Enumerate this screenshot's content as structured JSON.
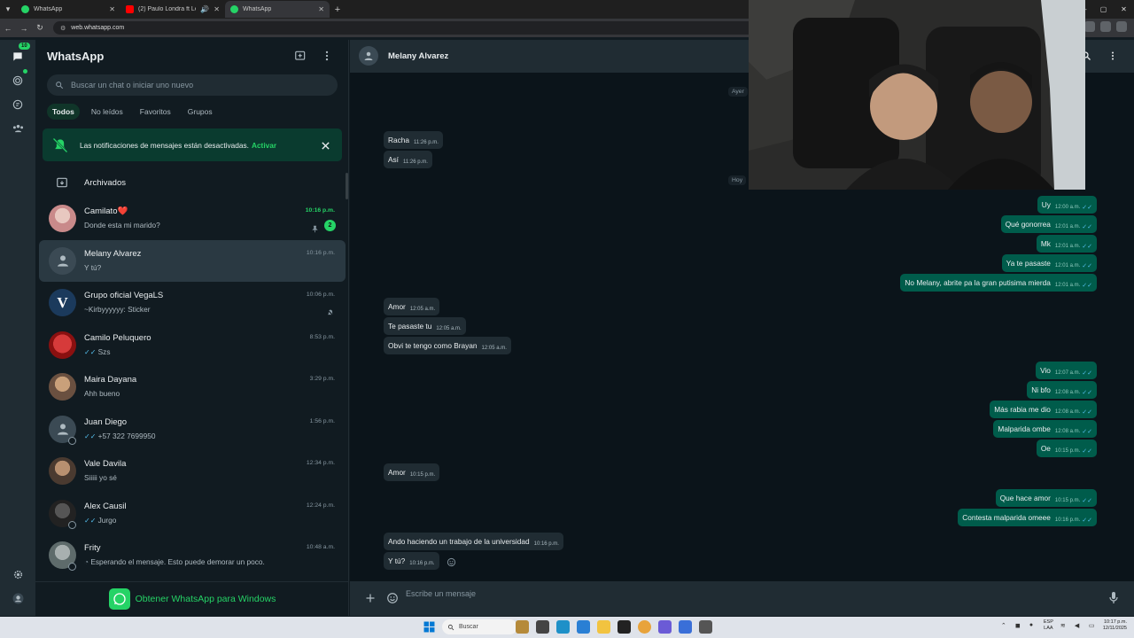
{
  "browser": {
    "tabs": [
      {
        "title": "WhatsApp",
        "active": false
      },
      {
        "title": "(2) Paulo Londra ft Lenny Ta",
        "active": false
      },
      {
        "title": "WhatsApp",
        "active": true
      }
    ],
    "url": "web.whatsapp.com"
  },
  "rail": {
    "chats_badge": "10"
  },
  "sidebar": {
    "title": "WhatsApp",
    "search_placeholder": "Buscar un chat o iniciar uno nuevo",
    "filters": [
      "Todos",
      "No leídos",
      "Favoritos",
      "Grupos"
    ],
    "active_filter": "Todos",
    "notification": {
      "text": "Las notificaciones de mensajes están desactivadas.",
      "link": "Activar"
    },
    "archived_label": "Archivados",
    "chats": [
      {
        "name": "Camilato❤️",
        "preview": "Donde esta mi marido?",
        "time": "10:16 p.m.",
        "unread": "2",
        "pinned": true,
        "avatar": "photo-pink"
      },
      {
        "name": "Melany Alvarez",
        "preview": "Y tú?",
        "time": "10:16 p.m.",
        "selected": true,
        "avatar": "person"
      },
      {
        "name": "Grupo oficial VegaLS",
        "preview": "~Kirbyyyyyy: Sticker",
        "time": "10:06 p.m.",
        "muted": true,
        "avatar": "logo-v"
      },
      {
        "name": "Camilo Peluquero",
        "preview": "Szs",
        "time": "8:53 p.m.",
        "tick": true,
        "avatar": "photo-red"
      },
      {
        "name": "Maira Dayana",
        "preview": "Ahh bueno",
        "time": "3:29 p.m.",
        "avatar": "photo-tan"
      },
      {
        "name": "Juan Diego",
        "preview": "+57 322 7699950",
        "time": "1:56 p.m.",
        "tick": true,
        "avatar": "person",
        "status": true
      },
      {
        "name": "Vale Davila",
        "preview": "Siiiii yo sé",
        "time": "12:34 p.m.",
        "avatar": "photo-brown"
      },
      {
        "name": "Alex Causil",
        "preview": "Jurgo",
        "time": "12:24 p.m.",
        "tick": true,
        "avatar": "photo-dark",
        "status": true
      },
      {
        "name": "Frity",
        "preview": "Esperando el mensaje. Esto puede demorar un poco.",
        "time": "10:48 a.m.",
        "avatar": "photo-gray",
        "status": true
      }
    ],
    "get_app_label": "Obtener WhatsApp para Windows"
  },
  "conversation": {
    "contact_name": "Melany Alvarez",
    "dates": [
      "Ayer",
      "Hoy"
    ],
    "messages": [
      {
        "dir": "in",
        "text": "Racha",
        "time": "11:26 p.m."
      },
      {
        "dir": "in",
        "text": "Así",
        "time": "11:26 p.m."
      },
      {
        "dir": "out",
        "text": "Uy",
        "time": "12:00 a.m."
      },
      {
        "dir": "out",
        "text": "Qué gonorrea",
        "time": "12:01 a.m."
      },
      {
        "dir": "out",
        "text": "Mk",
        "time": "12:01 a.m."
      },
      {
        "dir": "out",
        "text": "Ya te pasaste",
        "time": "12:01 a.m."
      },
      {
        "dir": "out",
        "text": "No Melany, abrite pa la gran putisima mierda",
        "time": "12:01 a.m."
      },
      {
        "dir": "in",
        "text": "Amor",
        "time": "12:05 a.m."
      },
      {
        "dir": "in",
        "text": "Te pasaste tu",
        "time": "12:05 a.m."
      },
      {
        "dir": "in",
        "text": "Obvi te tengo como Brayan",
        "time": "12:05 a.m."
      },
      {
        "dir": "out",
        "text": "Vio",
        "time": "12:07 a.m."
      },
      {
        "dir": "out",
        "text": "Ni bfo",
        "time": "12:08 a.m."
      },
      {
        "dir": "out",
        "text": "Más rabia me dio",
        "time": "12:08 a.m."
      },
      {
        "dir": "out",
        "text": "Malparida ombe",
        "time": "12:08 a.m."
      },
      {
        "dir": "out",
        "text": "Oe",
        "time": "10:15 p.m."
      },
      {
        "dir": "in",
        "text": "Amor",
        "time": "10:15 p.m."
      },
      {
        "dir": "out",
        "text": "Que hace amor",
        "time": "10:15 p.m."
      },
      {
        "dir": "out",
        "text": "Contesta malparida omeee",
        "time": "10:16 p.m."
      },
      {
        "dir": "in",
        "text": "Ando haciendo un trabajo de la universidad",
        "time": "10:16 p.m."
      },
      {
        "dir": "in",
        "text": "Y tú?",
        "time": "10:16 p.m."
      }
    ],
    "composer_placeholder": "Escribe un mensaje"
  },
  "taskbar": {
    "search_label": "Buscar",
    "lang": [
      "ESP",
      "LAA"
    ],
    "time": "10:17 p.m.",
    "date": "12/11/2025"
  },
  "colors": {
    "accent": "#25d366",
    "bg_dark": "#111b21",
    "bubble_out": "#005c4b",
    "bubble_in": "#202c33",
    "read_tick": "#53bdeb"
  }
}
